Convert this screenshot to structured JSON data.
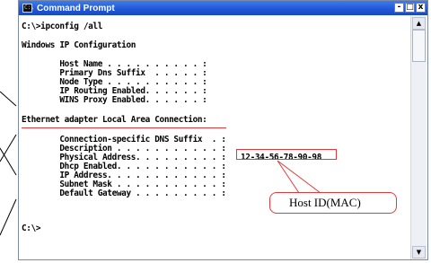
{
  "window": {
    "title": "Command Prompt",
    "icon_label": "C:\\",
    "controls": {
      "minimize": "-",
      "maximize": "□",
      "close": "x"
    }
  },
  "console": {
    "lines": [
      "C:\\>ipconfig /all",
      "",
      "Windows IP Configuration",
      "",
      "        Host Name . . . . . . . . . . :",
      "        Primary Dns Suffix  . . . . . :",
      "        Node Type . . . . . . . . . . :",
      "        IP Routing Enabled. . . . . . :",
      "        WINS Proxy Enabled. . . . . . :",
      "",
      "Ethernet adapter Local Area Connection:",
      "",
      "        Connection-specific DNS Suffix  . :",
      "        Description . . . . . . . . . . . :",
      "        Physical Address. . . . . . . . . :",
      "        Dhcp Enabled. . . . . . . . . . . :",
      "        IP Address. . . . . . . . . . . . :",
      "        Subnet Mask . . . . . . . . . . . :",
      "        Default Gateway . . . . . . . . . :",
      "",
      "C:\\>"
    ],
    "mac_address": "12-34-56-78-90-98"
  },
  "annotation": {
    "callout_label": "Host ID(MAC)",
    "accent_color": "#e23a3a"
  },
  "scrollbar": {
    "up": "▲",
    "down": "▼"
  }
}
